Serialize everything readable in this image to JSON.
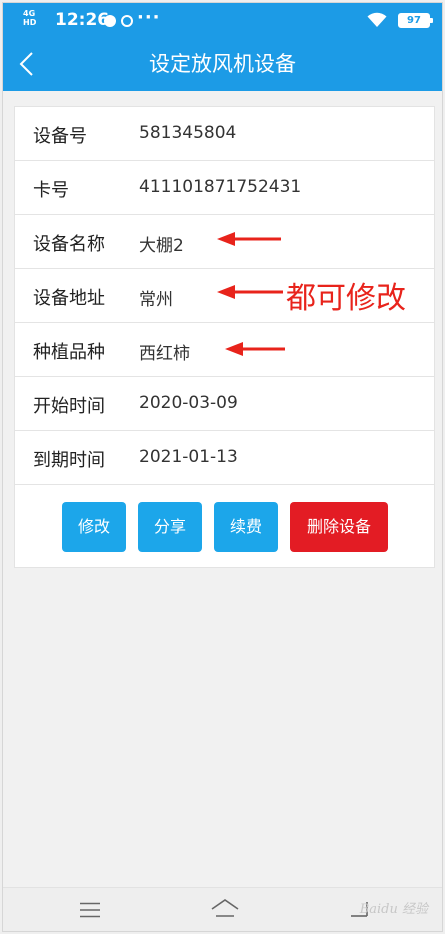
{
  "status_bar": {
    "network": "4G HD",
    "time": "12:26",
    "more": "···",
    "battery": "97"
  },
  "header": {
    "title": "设定放风机设备"
  },
  "details": [
    {
      "label": "设备号",
      "value": "581345804"
    },
    {
      "label": "卡号",
      "value": "411101871752431"
    },
    {
      "label": "设备名称",
      "value": "大棚2"
    },
    {
      "label": "设备地址",
      "value": "常州"
    },
    {
      "label": "种植品种",
      "value": "西红柿"
    },
    {
      "label": "开始时间",
      "value": "2020-03-09"
    },
    {
      "label": "到期时间",
      "value": "2021-01-13"
    }
  ],
  "annotation": {
    "text": "都可修改",
    "color": "#e8231b"
  },
  "buttons": {
    "edit": "修改",
    "share": "分享",
    "renew": "续费",
    "delete": "删除设备"
  },
  "nav": {
    "icons": [
      "menu-icon",
      "home-icon",
      "back-icon"
    ]
  },
  "colors": {
    "primary": "#1c9be6",
    "button_blue": "#1ca6ea",
    "button_red": "#e31c24"
  }
}
